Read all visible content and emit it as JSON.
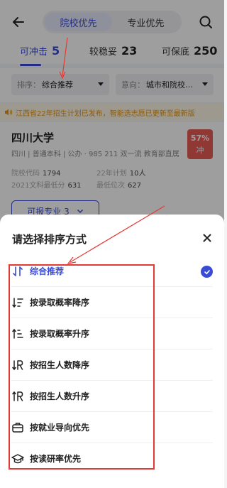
{
  "header": {
    "tabs": [
      {
        "label": "院校优先",
        "active": true
      },
      {
        "label": "专业优先",
        "active": false
      }
    ]
  },
  "stats": [
    {
      "label": "可冲击",
      "value": "5",
      "active": true
    },
    {
      "label": "较稳妥",
      "value": "23",
      "active": false
    },
    {
      "label": "可保底",
      "value": "250",
      "active": false
    }
  ],
  "filters": {
    "sort": {
      "prefix": "排序：",
      "value": "综合推荐"
    },
    "intent": {
      "prefix": "意向：",
      "value": "城市和院校…"
    }
  },
  "notice": "江西省22年招生计划已发布，智能选志愿已更新至最新版",
  "school": {
    "name": "四川大学",
    "meta": "四川 | 普通本科 | 公办 · 985 211 双一流 教育部直属",
    "probability": "57%",
    "probability_tag": "冲",
    "info": [
      {
        "label": "院校代码",
        "value": "1794"
      },
      {
        "label": "22年计划",
        "value": "10人"
      },
      {
        "label": "2021文科最低分",
        "value": "631"
      },
      {
        "label": "最低位次",
        "value": "627"
      }
    ],
    "major_button": "可报专业 3"
  },
  "sheet": {
    "title": "请选择排序方式",
    "options": [
      {
        "label": "综合推荐",
        "icon": "sort-swap-icon",
        "selected": true
      },
      {
        "label": "按录取概率降序",
        "icon": "sort-desc-icon",
        "selected": false
      },
      {
        "label": "按录取概率升序",
        "icon": "sort-asc-icon",
        "selected": false
      },
      {
        "label": "按招生人数降序",
        "icon": "enroll-desc-icon",
        "selected": false
      },
      {
        "label": "按招生人数升序",
        "icon": "enroll-asc-icon",
        "selected": false
      },
      {
        "label": "按就业导向优先",
        "icon": "briefcase-icon",
        "selected": false
      },
      {
        "label": "按读研率优先",
        "icon": "graduation-cap-icon",
        "selected": false
      }
    ]
  },
  "colors": {
    "accent": "#3a4bd6",
    "danger": "#e85b55",
    "notice": "#e8930c",
    "annotation": "#e53935"
  }
}
